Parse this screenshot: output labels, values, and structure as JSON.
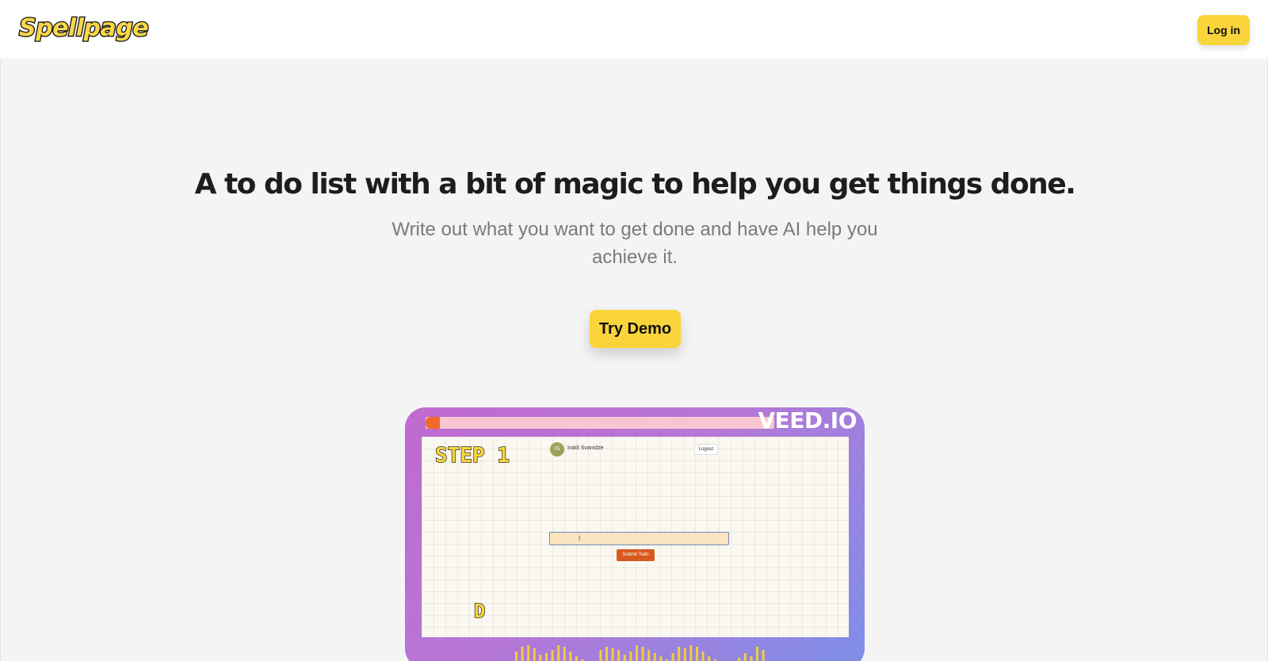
{
  "header": {
    "logo_text": "Spellpage",
    "login_label": "Log in"
  },
  "hero": {
    "headline": "A to do list with a bit of magic to help you get things done.",
    "subheadline": "Write out what you want to get done and have AI help you achieve it.",
    "cta_label": "Try Demo"
  },
  "video": {
    "watermark": "VEED.IO",
    "progress_fraction": 0.04,
    "step_label": "STEP 1",
    "app": {
      "avatar_initials": "IS",
      "user_name": "Irakli Svanidze",
      "logout_label": "Logout",
      "input_value": "I",
      "submit_label": "Submit Todo"
    },
    "caption_letter": "D"
  },
  "colors": {
    "accent_yellow": "#f9d43a",
    "background": "#f4f4f4",
    "video_gradient_start": "#c06ad0",
    "video_gradient_end": "#7c8fe8",
    "progress_fill": "#f06a2c",
    "submit_button": "#d9581d"
  }
}
